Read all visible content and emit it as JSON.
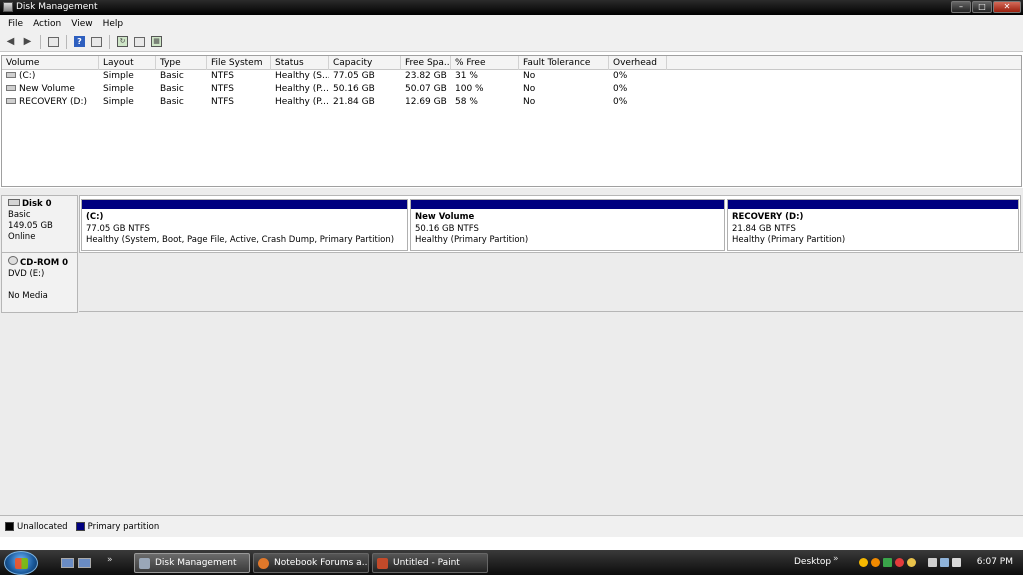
{
  "window": {
    "title": "Disk Management",
    "min": "–",
    "max": "□",
    "close": "✕"
  },
  "menu": [
    "File",
    "Action",
    "View",
    "Help"
  ],
  "toolbar": {
    "icons": [
      "back-arrow-icon",
      "forward-arrow-icon",
      "console-tree-icon",
      "help-icon",
      "show-hide-icon",
      "refresh-icon",
      "properties-icon",
      "rescan-icon"
    ],
    "help_glyph": "?"
  },
  "volume_list": {
    "columns": [
      "Volume",
      "Layout",
      "Type",
      "File System",
      "Status",
      "Capacity",
      "Free Spa...",
      "% Free",
      "Fault Tolerance",
      "Overhead"
    ],
    "rows": [
      [
        "(C:)",
        "Simple",
        "Basic",
        "NTFS",
        "Healthy (S...",
        "77.05 GB",
        "23.82 GB",
        "31 %",
        "No",
        "0%"
      ],
      [
        "New Volume",
        "Simple",
        "Basic",
        "NTFS",
        "Healthy (P...",
        "50.16 GB",
        "50.07 GB",
        "100 %",
        "No",
        "0%"
      ],
      [
        "RECOVERY (D:)",
        "Simple",
        "Basic",
        "NTFS",
        "Healthy (P...",
        "21.84 GB",
        "12.69 GB",
        "58 %",
        "No",
        "0%"
      ]
    ]
  },
  "disks": [
    {
      "name": "Disk 0",
      "type": "Basic",
      "size": "149.05 GB",
      "status": "Online",
      "partitions": [
        {
          "name": "(C:)",
          "size": "77.05 GB NTFS",
          "status": "Healthy (System, Boot, Page File, Active, Crash Dump, Primary Partition)"
        },
        {
          "name": "New Volume",
          "size": "50.16 GB NTFS",
          "status": "Healthy (Primary Partition)"
        },
        {
          "name": "RECOVERY  (D:)",
          "size": "21.84 GB NTFS",
          "status": "Healthy (Primary Partition)"
        }
      ]
    }
  ],
  "cdrom": {
    "name": "CD-ROM 0",
    "type": "DVD (E:)",
    "status": "No Media"
  },
  "legend": [
    {
      "label": "Unallocated",
      "color": "#000000"
    },
    {
      "label": "Primary partition",
      "color": "#000080"
    }
  ],
  "taskbar": {
    "quicklaunch_more": "»",
    "tasks": [
      {
        "label": "Disk Management",
        "active": true
      },
      {
        "label": "Notebook Forums a...",
        "active": false
      },
      {
        "label": "Untitled - Paint",
        "active": false
      }
    ],
    "desktop": "Desktop",
    "desktop_more": "»",
    "clock": "6:07 PM"
  }
}
